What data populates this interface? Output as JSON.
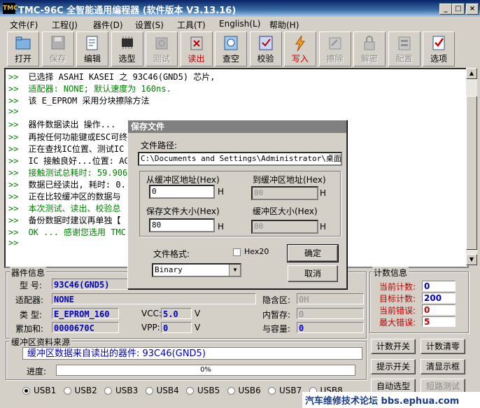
{
  "window": {
    "title": "TMC-96C 全智能通用编程器 (软件版本 V3.13.16)",
    "icon_text": "TMC"
  },
  "menu": [
    "文件(F)",
    "工程(J)",
    "器件(D)",
    "设置(S)",
    "工具(T)",
    "English(L)",
    "帮助(H)"
  ],
  "toolbar": [
    {
      "label": "打开",
      "icon": "folder-icon",
      "state": "normal"
    },
    {
      "label": "保存",
      "icon": "save-icon",
      "state": "disabled"
    },
    {
      "label": "编辑",
      "icon": "edit-icon",
      "state": "normal"
    },
    {
      "label": "选型",
      "icon": "chip-icon",
      "state": "normal"
    },
    {
      "label": "测试",
      "icon": "test-icon",
      "state": "disabled"
    },
    {
      "label": "读出",
      "icon": "read-icon",
      "state": "red"
    },
    {
      "label": "查空",
      "icon": "blank-check-icon",
      "state": "normal"
    },
    {
      "label": "校验",
      "icon": "verify-icon",
      "state": "normal"
    },
    {
      "label": "写入",
      "icon": "write-icon",
      "state": "red"
    },
    {
      "label": "擦除",
      "icon": "erase-icon",
      "state": "disabled"
    },
    {
      "label": "解密",
      "icon": "decrypt-icon",
      "state": "disabled"
    },
    {
      "label": "配置",
      "icon": "config-icon",
      "state": "disabled"
    },
    {
      "label": "选项",
      "icon": "options-icon",
      "state": "normal"
    }
  ],
  "log": [
    {
      "prompt": ">>",
      "text": "已选择 ASAHI KASEI 之 93C46(GND5) 芯片,",
      "color": "#000000"
    },
    {
      "prompt": ">>",
      "text": "适配器: NONE;  默认速度为 160ns.",
      "color": "#008000"
    },
    {
      "prompt": ">>",
      "text": "该 E_EPROM 采用分块擦除方法",
      "color": "#000000"
    },
    {
      "prompt": ">>",
      "text": "",
      "color": "#000000"
    },
    {
      "prompt": ">>",
      "text": "器件数据读出 操作...",
      "color": "#000000"
    },
    {
      "prompt": ">>",
      "text": "再按任何功能键或ESC可终",
      "color": "#000000"
    },
    {
      "prompt": ">>",
      "text": "正在查找IC位置、测试IC",
      "color": "#000000"
    },
    {
      "prompt": ">>",
      "text": "IC 接触良好...位置: AG",
      "color": "#000000"
    },
    {
      "prompt": ">>",
      "text": "接触测试总耗时: 59.906",
      "color": "#008000"
    },
    {
      "prompt": ">>",
      "text": "数据已经读出, 耗时: 0.",
      "color": "#000000"
    },
    {
      "prompt": ">>",
      "text": "正在比较缓冲区的数据与",
      "color": "#000000"
    },
    {
      "prompt": ">>",
      "text": "本次测试、读出、校验总",
      "color": "#008000"
    },
    {
      "prompt": ">>",
      "text": "备份数据时建议再单独【",
      "color": "#000000"
    },
    {
      "prompt": ">>",
      "text": "OK ... 感谢您选用 TMC",
      "color": "#008000"
    },
    {
      "prompt": ">>",
      "text": "",
      "color": "#000000"
    }
  ],
  "device_info": {
    "title": "器件信息",
    "model_label": "型 号:",
    "model": "93C46(GND5)",
    "adapter_label": "适配器:",
    "adapter": "NONE",
    "type_label": "类 型:",
    "type": "E_EPROM_160",
    "checksum_label": "累加和:",
    "checksum": "0000670C",
    "vcc_label": "VCC:",
    "vcc": "5.0",
    "vcc_unit": "V",
    "vpp_label": "VPP:",
    "vpp": "0",
    "vpp_unit": "V",
    "hidden_label": "隐含区:",
    "hidden": "0H",
    "temp_label": "内暂存:",
    "temp": "0",
    "capacity_label": "与容量:",
    "capacity": "0"
  },
  "buffer": {
    "title": "缓冲区资料来源",
    "source_text": "缓冲区数据来自读出的器件: 93C46(GND5)",
    "progress_label": "进度:",
    "progress_text": "0%",
    "progress": 0
  },
  "usb": {
    "options": [
      "USB1",
      "USB2",
      "USB3",
      "USB4",
      "USB5",
      "USB6",
      "USB7",
      "USB8"
    ],
    "selected": "USB1"
  },
  "counter": {
    "title": "计数信息",
    "current_label": "当前计数:",
    "current": "0",
    "target_label": "目标计数:",
    "target": "200",
    "errors_label": "当前错误:",
    "errors": "0",
    "max_errors_label": "最大错误:",
    "max_errors": "5"
  },
  "side_buttons": [
    "计数开关",
    "计数清零",
    "提示开关",
    "清显示框",
    "自动选型",
    "短路测试"
  ],
  "dialog": {
    "title": "保存文件",
    "path_label": "文件路径:",
    "path": "C:\\Documents and Settings\\Administrator\\桌面\\伊兰",
    "from_addr_label": "从缓冲区地址(Hex)",
    "from_addr": "0",
    "from_unit": "H",
    "to_addr_label": "到缓冲区地址(Hex)",
    "to_addr": "80",
    "to_unit": "H",
    "save_size_label": "保存文件大小(Hex)",
    "save_size": "80",
    "save_unit": "H",
    "buf_size_label": "缓冲区大小(Hex)",
    "buf_size": "80",
    "buf_unit": "H",
    "format_label": "文件格式:",
    "format": "Binary",
    "hex20_label": "Hex20",
    "ok_label": "确定",
    "cancel_label": "取消"
  },
  "watermark": "汽车维修技术论坛 bbs.ephua.com"
}
